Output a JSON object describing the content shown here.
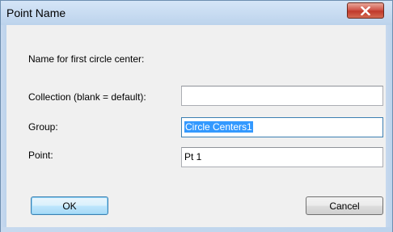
{
  "window": {
    "title": "Point Name",
    "close_icon": "close-x-icon"
  },
  "dialog": {
    "prompt": "Name for first circle center:",
    "fields": {
      "collection": {
        "label": "Collection (blank = default):",
        "value": ""
      },
      "group": {
        "label": "Group:",
        "value": "Circle Centers1"
      },
      "point": {
        "label": "Point:",
        "value": "Pt 1"
      }
    },
    "buttons": {
      "ok": "OK",
      "cancel": "Cancel"
    }
  },
  "colors": {
    "selection": "#3399ff",
    "close_button": "#c0392b",
    "titlebar": "#bcd3ec"
  }
}
